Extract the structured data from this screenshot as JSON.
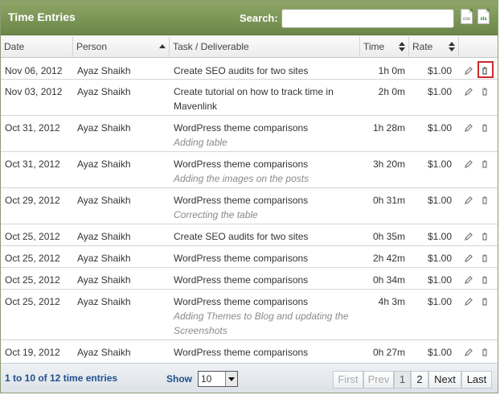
{
  "titlebar": {
    "title": "Time Entries",
    "search_label": "Search:",
    "search_value": "",
    "export_csv": "csv",
    "export_xls": "xls",
    "accent_color": "#6b8648"
  },
  "columns": {
    "date": "Date",
    "person": "Person",
    "task": "Task / Deliverable",
    "time": "Time",
    "rate": "Rate"
  },
  "rows": [
    {
      "date": "Nov 06, 2012",
      "person": "Ayaz Shaikh",
      "task": "Create SEO audits for two sites",
      "note": "",
      "time": "1h 0m",
      "rate": "$1.00"
    },
    {
      "date": "Nov 03, 2012",
      "person": "Ayaz Shaikh",
      "task": "Create tutorial on how to track time in Mavenlink",
      "note": "",
      "time": "2h 0m",
      "rate": "$1.00"
    },
    {
      "date": "Oct 31, 2012",
      "person": "Ayaz Shaikh",
      "task": "WordPress theme comparisons",
      "note": "Adding table",
      "time": "1h 28m",
      "rate": "$1.00"
    },
    {
      "date": "Oct 31, 2012",
      "person": "Ayaz Shaikh",
      "task": "WordPress theme comparisons",
      "note": "Adding the images on the posts",
      "time": "3h 20m",
      "rate": "$1.00"
    },
    {
      "date": "Oct 29, 2012",
      "person": "Ayaz Shaikh",
      "task": "WordPress theme comparisons",
      "note": "Correcting the table",
      "time": "0h 31m",
      "rate": "$1.00"
    },
    {
      "date": "Oct 25, 2012",
      "person": "Ayaz Shaikh",
      "task": "Create SEO audits for two sites",
      "note": "",
      "time": "0h 35m",
      "rate": "$1.00"
    },
    {
      "date": "Oct 25, 2012",
      "person": "Ayaz Shaikh",
      "task": "WordPress theme comparisons",
      "note": "",
      "time": "2h 42m",
      "rate": "$1.00"
    },
    {
      "date": "Oct 25, 2012",
      "person": "Ayaz Shaikh",
      "task": "WordPress theme comparisons",
      "note": "",
      "time": "0h 34m",
      "rate": "$1.00"
    },
    {
      "date": "Oct 25, 2012",
      "person": "Ayaz Shaikh",
      "task": "WordPress theme comparisons",
      "note": "Adding Themes to Blog and updating the Screenshots",
      "time": "4h 3m",
      "rate": "$1.00"
    },
    {
      "date": "Oct 19, 2012",
      "person": "Ayaz Shaikh",
      "task": "WordPress theme comparisons",
      "note": "",
      "time": "0h 27m",
      "rate": "$1.00"
    }
  ],
  "footer": {
    "summary": "1 to 10 of 12 time entries",
    "show_label": "Show",
    "show_value": "10",
    "pager": {
      "first": "First",
      "prev": "Prev",
      "page1": "1",
      "page2": "2",
      "next": "Next",
      "last": "Last"
    }
  }
}
